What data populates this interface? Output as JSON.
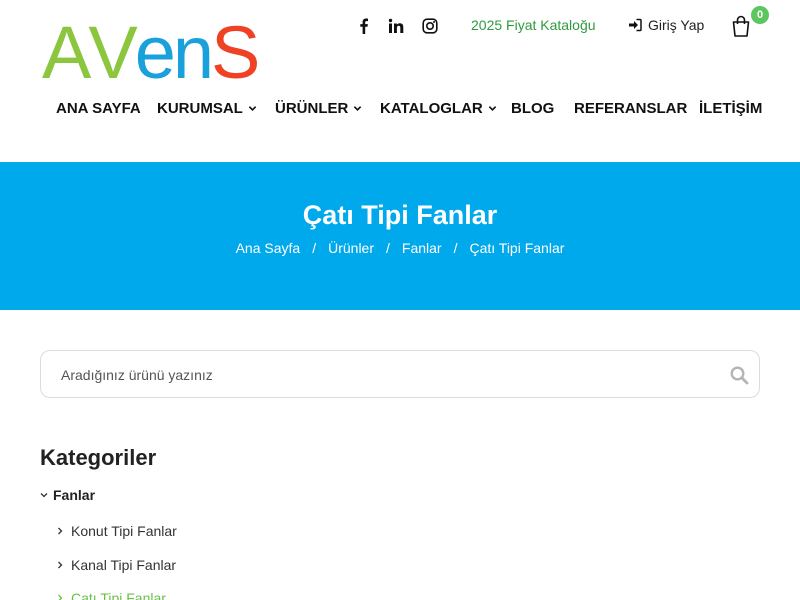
{
  "logo": {
    "letters": [
      "A",
      "V",
      "e",
      "n",
      "S"
    ],
    "colors": [
      "#8cc63f",
      "#8cc63f",
      "#1aa0db",
      "#1aa0db",
      "#ef4123"
    ]
  },
  "topbar": {
    "social": [
      "facebook-icon",
      "linkedin-icon",
      "instagram-icon"
    ],
    "catalog_link": "2025 Fiyat Kataloğu",
    "login_label": "Giriş Yap",
    "cart_count": "0"
  },
  "nav": {
    "items": [
      {
        "label": "ANA SAYFA",
        "dropdown": false
      },
      {
        "label": "KURUMSAL",
        "dropdown": true
      },
      {
        "label": "ÜRÜNLER",
        "dropdown": true
      },
      {
        "label": "KATALOGLAR",
        "dropdown": true
      },
      {
        "label": "BLOG",
        "dropdown": false
      },
      {
        "label": "REFERANSLAR",
        "dropdown": false
      },
      {
        "label": "İLETİŞİM",
        "dropdown": false
      }
    ]
  },
  "banner": {
    "title": "Çatı Tipi Fanlar",
    "breadcrumb": [
      "Ana Sayfa",
      "Ürünler",
      "Fanlar",
      "Çatı Tipi Fanlar"
    ],
    "separator": "/"
  },
  "search": {
    "placeholder": "Aradığınız ürünü yazınız"
  },
  "categories": {
    "title": "Kategoriler",
    "root": "Fanlar",
    "items": [
      {
        "label": "Konut Tipi Fanlar",
        "active": false
      },
      {
        "label": "Kanal Tipi Fanlar",
        "active": false
      },
      {
        "label": "Çatı Tipi Fanlar",
        "active": true
      }
    ]
  },
  "colors": {
    "banner": "#00a8ec",
    "accent_green": "#2e9a3e",
    "active_category": "#6cc04a",
    "badge": "#5cc65f"
  }
}
